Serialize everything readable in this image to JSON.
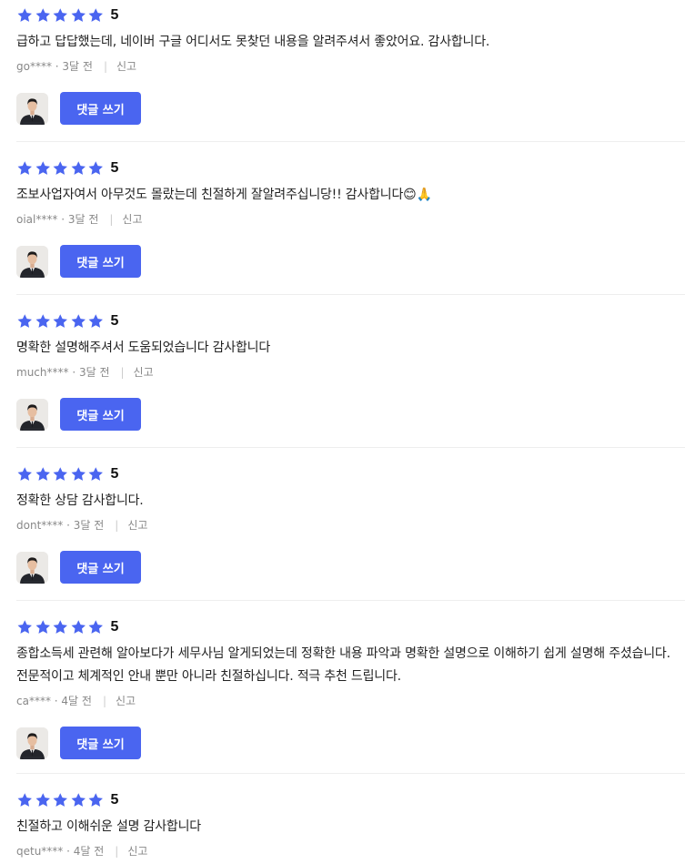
{
  "star_color": "#4a65f0",
  "button_color": "#4a65f0",
  "reviews": [
    {
      "score": "5",
      "text": "급하고 답답했는데, 네이버 구글 어디서도 못찾던 내용을 알려주셔서 좋았어요. 감사합니다.",
      "author": "go****",
      "time": "3달 전",
      "report": "신고",
      "reply_label": "댓글 쓰기"
    },
    {
      "score": "5",
      "text": "조보사업자여서 아무것도 몰랐는데 친절하게 잘알려주십니당!! 감사합니다😊🙏",
      "author": "oial****",
      "time": "3달 전",
      "report": "신고",
      "reply_label": "댓글 쓰기"
    },
    {
      "score": "5",
      "text": "명확한 설명해주셔서 도움되었습니다 감사합니다",
      "author": "much****",
      "time": "3달 전",
      "report": "신고",
      "reply_label": "댓글 쓰기"
    },
    {
      "score": "5",
      "text": "정확한 상담 감사합니다.",
      "author": "dont****",
      "time": "3달 전",
      "report": "신고",
      "reply_label": "댓글 쓰기"
    },
    {
      "score": "5",
      "text": "종합소득세 관련해 알아보다가 세무사님 알게되었는데 정확한 내용 파악과 명확한 설명으로 이해하기 쉽게 설명해 주셨습니다. 전문적이고 체계적인 안내 뿐만 아니라 친절하십니다. 적극 추천 드립니다.",
      "author": "ca****",
      "time": "4달 전",
      "report": "신고",
      "reply_label": "댓글 쓰기"
    },
    {
      "score": "5",
      "text": "친절하고 이해쉬운 설명 감사합니다",
      "author": "qetu****",
      "time": "4달 전",
      "report": "신고",
      "reply_label": ""
    }
  ]
}
